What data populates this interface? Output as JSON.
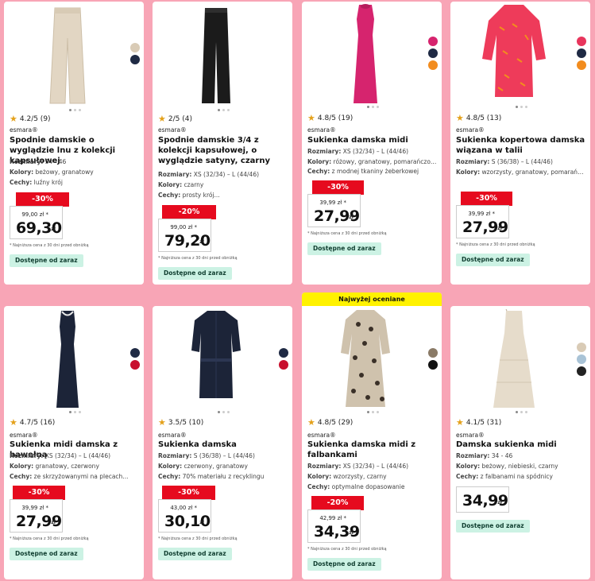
{
  "labels": {
    "rozmiary": "Rozmiary:",
    "kolory": "Kolory:",
    "cechy": "Cechy:",
    "zl": "zł",
    "note": "* Najniższa cena z 30 dni przed obniżką",
    "available": "Dostępne od zaraz",
    "top_badge": "Najwyżej oceniane"
  },
  "products": [
    {
      "rating": "4.2/5 (9)",
      "brand": "esmara®",
      "title": "Spodnie damskie o wyglądzie lnu z kolekcji kapsułowej",
      "sizes": "34 - 46",
      "colors": "beżowy, granatowy",
      "features": "luźny krój",
      "discount": "-30%",
      "old_price": "99,00 zł *",
      "price": "69,30",
      "swatch_colors": [
        "#d9cbb6",
        "#1f2a44"
      ],
      "icon": "pants-beige-icon"
    },
    {
      "rating": "2/5 (4)",
      "brand": "esmara®",
      "title": "Spodnie damskie 3/4 z kolekcji kapsułowej, o wyglądzie satyny, czarny",
      "sizes": "XS (32/34) – L (44/46)",
      "colors": "czarny",
      "features": "prosty krój...",
      "discount": "-20%",
      "old_price": "99,00 zł *",
      "price": "79,20",
      "swatch_colors": [],
      "icon": "pants-black-icon"
    },
    {
      "rating": "4.8/5 (19)",
      "brand": "esmara®",
      "title": "Sukienka damska midi",
      "sizes": "XS (32/34) – L (44/46)",
      "colors": "różowy, granatowy, pomarańczowy",
      "features": "z modnej tkaniny żeberkowej",
      "discount": "-30%",
      "old_price": "39,99 zł *",
      "price": "27,99",
      "swatch_colors": [
        "#d6246e",
        "#1f2a44",
        "#f28c1e"
      ],
      "icon": "dress-pink-icon"
    },
    {
      "rating": "4.8/5 (13)",
      "brand": "esmara®",
      "title": "Sukienka kopertowa damska wiązana w talii",
      "sizes": "S (36/38) – L (44/46)",
      "colors": "wzorzysty, granatowy, pomarańczowy...",
      "features": "",
      "discount": "-30%",
      "old_price": "39,99 zł *",
      "price": "27,99",
      "swatch_colors": [
        "#e8355c",
        "#1f2a44",
        "#f28c1e"
      ],
      "icon": "wrap-dress-pattern-icon"
    },
    {
      "rating": "4.7/5 (16)",
      "brand": "esmara®",
      "title": "Sukienka midi damska z bawełną",
      "sizes": "XS (32/34) – L (44/46)",
      "colors": "granatowy, czerwony",
      "features": "ze skrzyżowanymi na plecach...",
      "discount": "-30%",
      "old_price": "39,99 zł *",
      "price": "27,99",
      "swatch_colors": [
        "#1f2a44",
        "#c8102e"
      ],
      "icon": "dress-navy-icon"
    },
    {
      "rating": "3.5/5 (10)",
      "brand": "esmara®",
      "title": "Sukienka damska",
      "sizes": "S (36/38) – L (44/46)",
      "colors": "czerwony, granatowy",
      "features": "70% materiału z recyklingu",
      "discount": "-30%",
      "old_price": "43,00 zł *",
      "price": "30,10",
      "swatch_colors": [
        "#1f2a44",
        "#c8102e"
      ],
      "icon": "shirt-dress-navy-icon"
    },
    {
      "rating": "4.8/5 (29)",
      "brand": "esmara®",
      "title": "Sukienka damska midi z falbankami",
      "sizes": "XS (32/34) – L (44/46)",
      "colors": "wzorzysty, czarny",
      "features": "optymalne dopasowanie",
      "discount": "-20%",
      "old_price": "42,99 zł *",
      "price": "34,39",
      "swatch_colors": [
        "#8a7a66",
        "#111111"
      ],
      "icon": "dress-leopard-icon"
    },
    {
      "rating": "4.1/5 (31)",
      "brand": "esmara®",
      "title": "Damska sukienka midi",
      "sizes": "34 - 46",
      "colors": "beżowy, niebieski, czarny",
      "features": "z falbanami na spódnicy",
      "discount": "",
      "old_price": "",
      "price": "34,99",
      "swatch_colors": [
        "#d9cbb6",
        "#a9c3d6",
        "#222222"
      ],
      "icon": "dress-beige-icon"
    }
  ]
}
